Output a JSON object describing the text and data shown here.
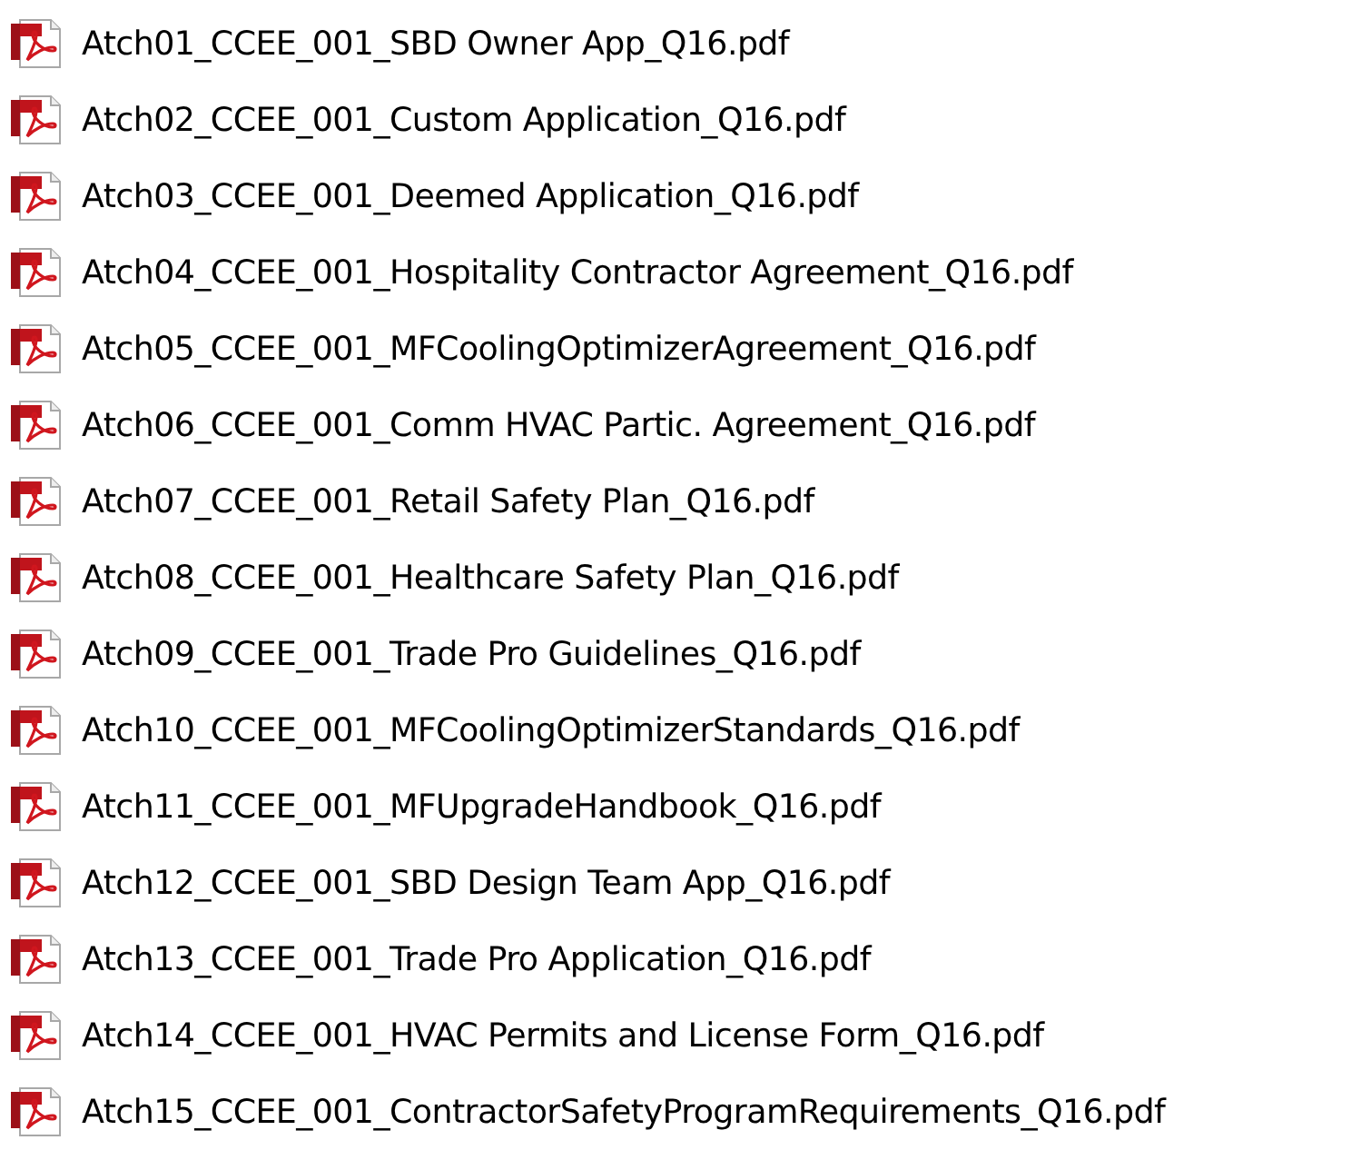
{
  "files": [
    {
      "name": "Atch01_CCEE_001_SBD Owner App_Q16.pdf"
    },
    {
      "name": "Atch02_CCEE_001_Custom Application_Q16.pdf"
    },
    {
      "name": "Atch03_CCEE_001_Deemed Application_Q16.pdf"
    },
    {
      "name": "Atch04_CCEE_001_Hospitality Contractor Agreement_Q16.pdf"
    },
    {
      "name": "Atch05_CCEE_001_MFCoolingOptimizerAgreement_Q16.pdf"
    },
    {
      "name": "Atch06_CCEE_001_Comm HVAC Partic. Agreement_Q16.pdf"
    },
    {
      "name": "Atch07_CCEE_001_Retail Safety Plan_Q16.pdf"
    },
    {
      "name": "Atch08_CCEE_001_Healthcare Safety Plan_Q16.pdf"
    },
    {
      "name": "Atch09_CCEE_001_Trade Pro Guidelines_Q16.pdf"
    },
    {
      "name": "Atch10_CCEE_001_MFCoolingOptimizerStandards_Q16.pdf"
    },
    {
      "name": "Atch11_CCEE_001_MFUpgradeHandbook_Q16.pdf"
    },
    {
      "name": "Atch12_CCEE_001_SBD Design Team App_Q16.pdf"
    },
    {
      "name": "Atch13_CCEE_001_Trade Pro Application_Q16.pdf"
    },
    {
      "name": "Atch14_CCEE_001_HVAC Permits and License Form_Q16.pdf"
    },
    {
      "name": "Atch15_CCEE_001_ContractorSafetyProgramRequirements_Q16.pdf"
    }
  ]
}
